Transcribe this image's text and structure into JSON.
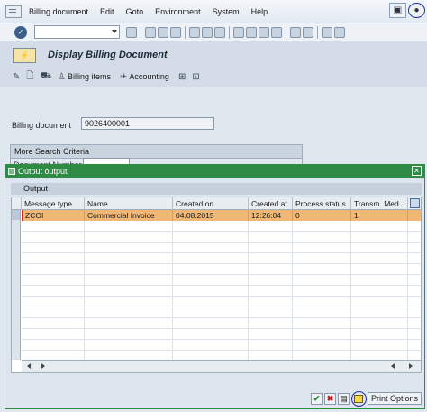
{
  "menu": {
    "items": [
      "Billing document",
      "Edit",
      "Goto",
      "Environment",
      "System",
      "Help"
    ]
  },
  "header": {
    "title": "Display Billing Document",
    "app_buttons": [
      "Billing items",
      "Accounting"
    ]
  },
  "form": {
    "billing_document_label": "Billing document",
    "billing_document_value": "9026400001",
    "group_title": "More Search Criteria",
    "partial_label": "Document Number"
  },
  "dialog": {
    "title": "Output output",
    "table_title": "Output",
    "columns": [
      "Message type",
      "Name",
      "Created on",
      "Created at",
      "Process.status",
      "Transm. Med..."
    ],
    "rows": [
      [
        "ZCOI",
        "Commercial Invoice",
        "04.08.2015",
        "12:26:04",
        "0",
        "1"
      ]
    ],
    "print_options_label": "Print Options"
  }
}
